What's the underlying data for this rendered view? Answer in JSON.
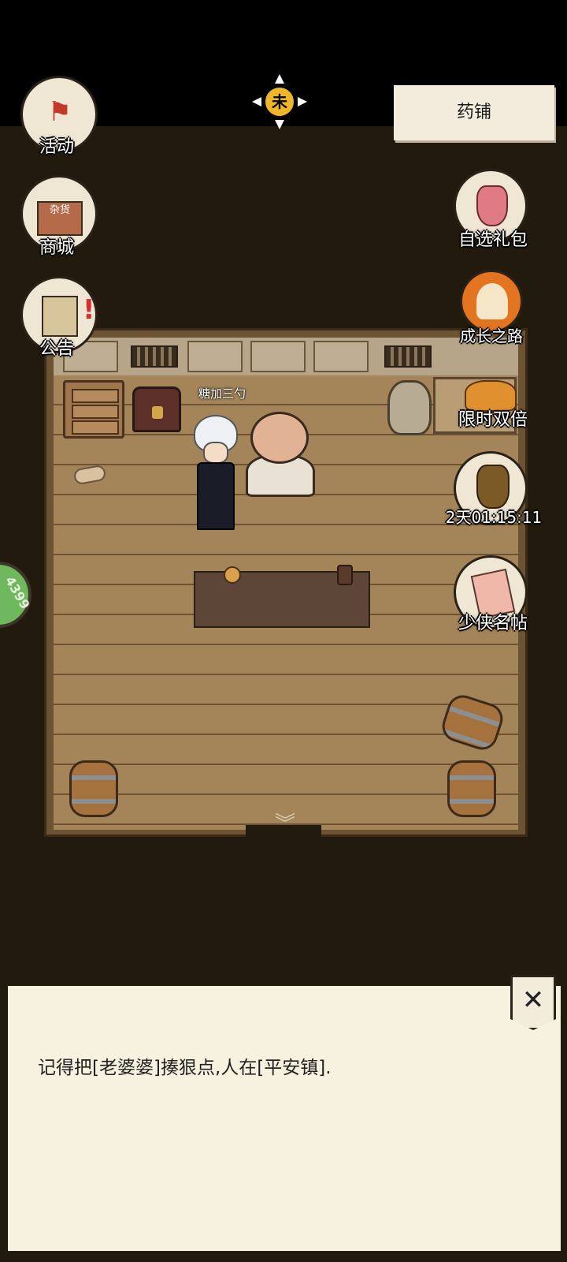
{
  "location": {
    "name": "药铺"
  },
  "time_badge": {
    "char": "未"
  },
  "left_menu": [
    {
      "label": "活动",
      "icon": "flag-icon"
    },
    {
      "label": "商城",
      "icon": "shop-icon"
    },
    {
      "label": "公告",
      "icon": "notice-icon"
    }
  ],
  "right_menu": [
    {
      "label": "自选礼包",
      "icon": "gift-bag-icon"
    },
    {
      "label": "成长之路",
      "icon": "growth-icon"
    },
    {
      "label": "限时双倍",
      "icon": "treasure-icon"
    },
    {
      "label": "2天01:15:11",
      "icon": "censer-icon"
    },
    {
      "label": "少侠名帖",
      "icon": "name-card-icon"
    }
  ],
  "shop_sign": "杂货",
  "side_tab": {
    "text": "4399"
  },
  "character": {
    "name": "糖加三勺"
  },
  "dialog": {
    "text": "记得把[老婆婆]揍狠点,人在[平安镇].",
    "close_symbol": "✕"
  },
  "scroll_arrow": "︾",
  "colors": {
    "background": "#221b0d",
    "panel": "#f7f1df",
    "floor": "#a48559",
    "accent_green": "#6fb85e"
  }
}
